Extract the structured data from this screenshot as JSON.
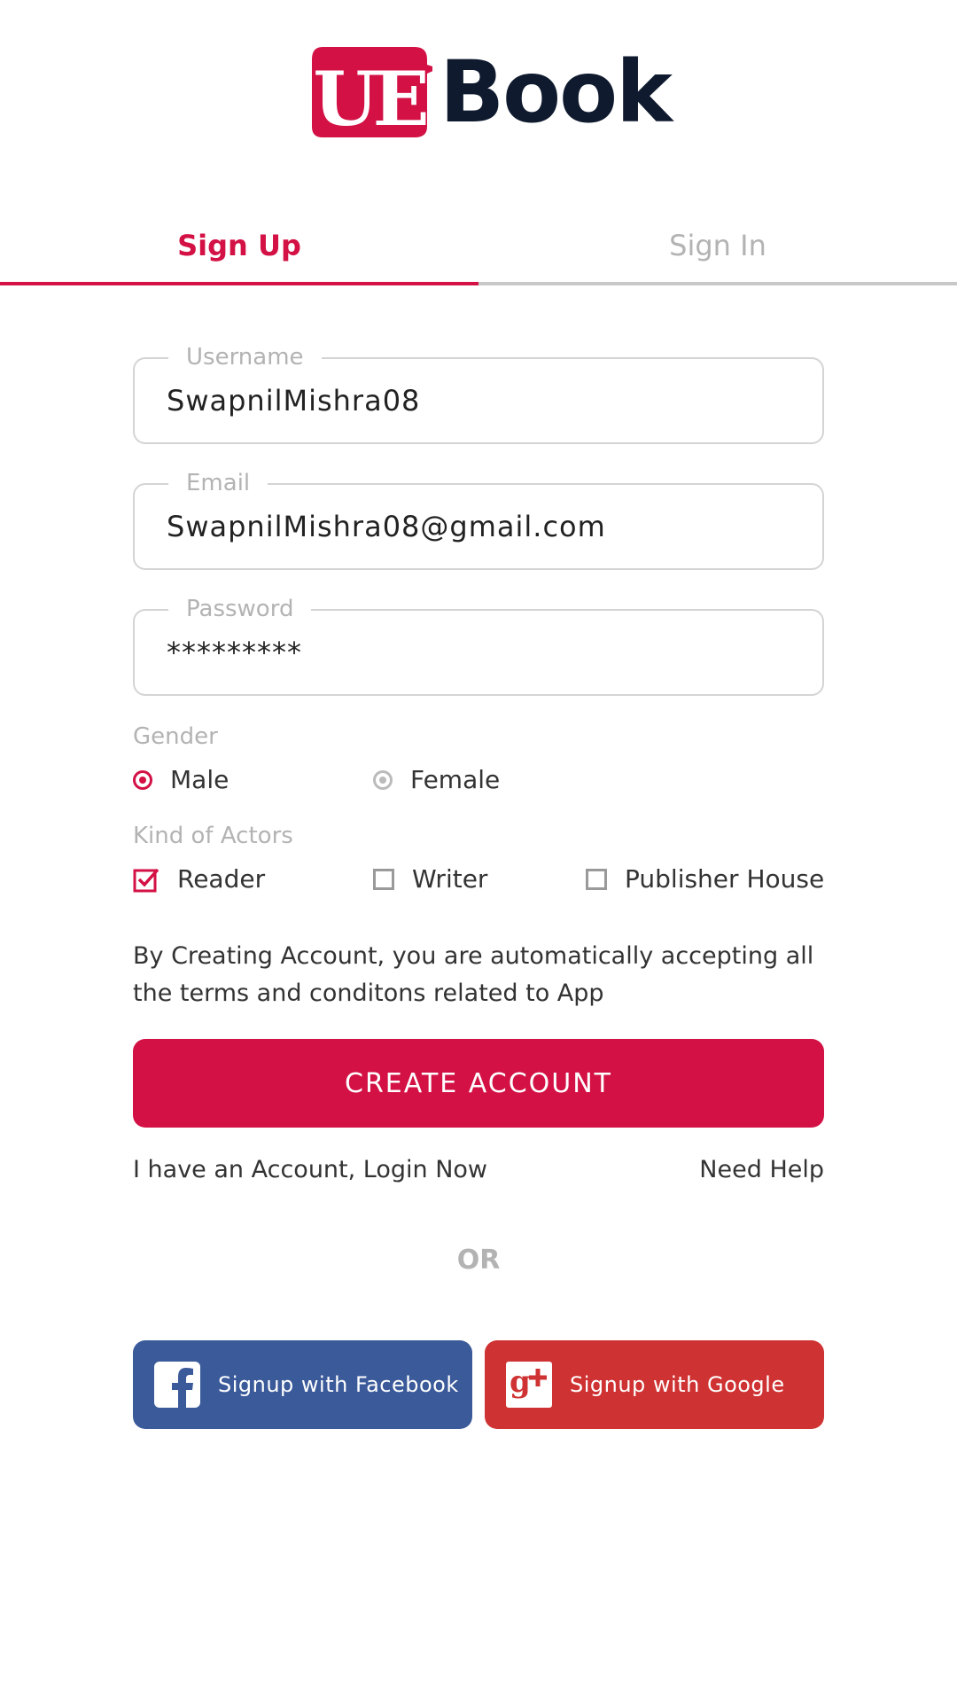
{
  "brand": {
    "logo_mark_text": "UE",
    "logo_text": "Book",
    "primary_color": "#d31145",
    "text_color": "#0f1a2e"
  },
  "tabs": [
    {
      "label": "Sign Up",
      "active": true
    },
    {
      "label": "Sign In",
      "active": false
    }
  ],
  "form": {
    "username": {
      "label": "Username",
      "value": "SwapnilMishra08"
    },
    "email": {
      "label": "Email",
      "value": "SwapnilMishra08@gmail.com"
    },
    "password": {
      "label": "Password",
      "value": "*********"
    },
    "gender": {
      "label": "Gender",
      "options": [
        {
          "label": "Male",
          "selected": true
        },
        {
          "label": "Female",
          "selected": false
        }
      ]
    },
    "actors": {
      "label": "Kind of Actors",
      "options": [
        {
          "label": "Reader",
          "checked": true
        },
        {
          "label": "Writer",
          "checked": false
        },
        {
          "label": "Publisher House",
          "checked": false
        }
      ]
    },
    "terms_text": "By Creating Account, you are automatically accepting all the terms and conditons related to App",
    "submit_label": "CREATE ACCOUNT"
  },
  "links": {
    "login": "I have an Account, Login Now",
    "help": "Need Help"
  },
  "divider_text": "OR",
  "social": {
    "facebook": {
      "label": "Signup with Facebook",
      "color": "#3b5a9a",
      "icon": "facebook-icon"
    },
    "google": {
      "label": "Signup with Google",
      "color": "#cf3232",
      "icon": "google-plus-icon"
    }
  }
}
